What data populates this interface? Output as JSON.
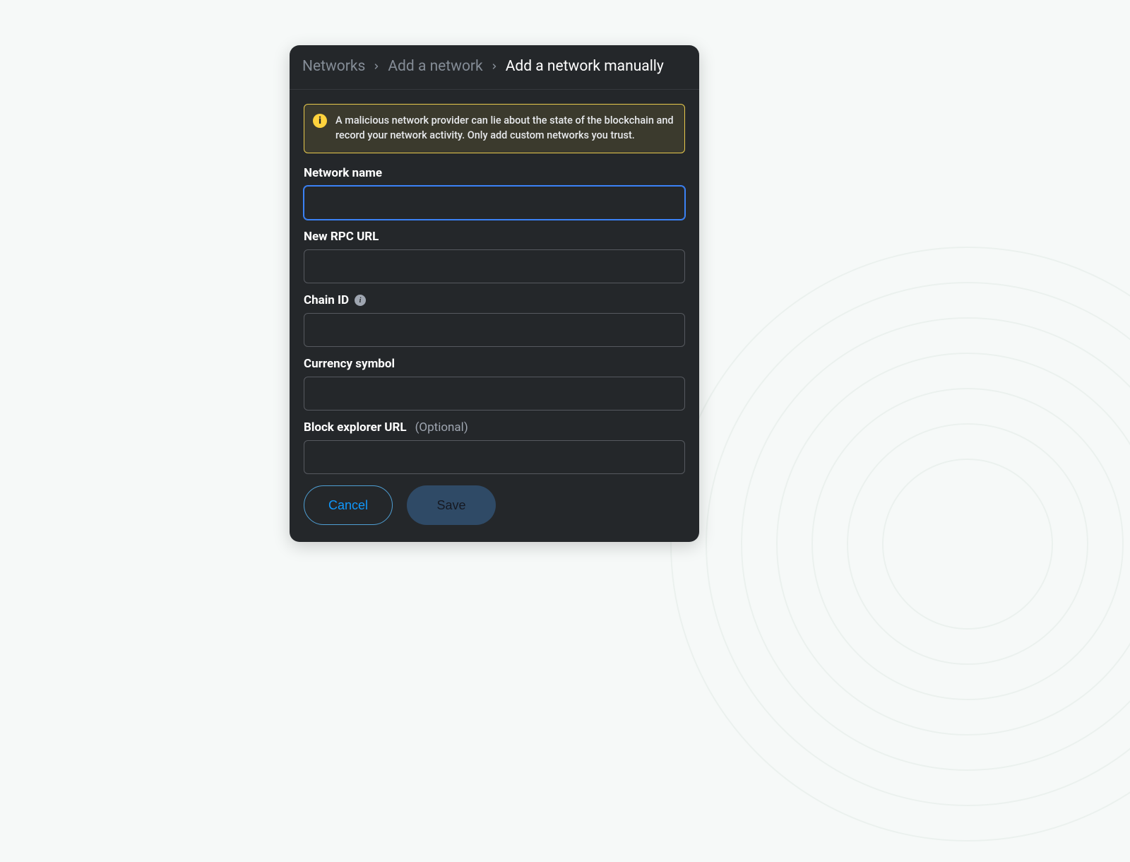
{
  "breadcrumb": {
    "items": [
      {
        "label": "Networks",
        "current": false
      },
      {
        "label": "Add a network",
        "current": false
      },
      {
        "label": "Add a network manually",
        "current": true
      }
    ]
  },
  "warning": {
    "text": "A malicious network provider can lie about the state of the blockchain and record your network activity. Only add custom networks you trust."
  },
  "form": {
    "network_name": {
      "label": "Network name",
      "value": ""
    },
    "rpc_url": {
      "label": "New RPC URL",
      "value": ""
    },
    "chain_id": {
      "label": "Chain ID",
      "value": ""
    },
    "currency": {
      "label": "Currency symbol",
      "value": ""
    },
    "explorer": {
      "label": "Block explorer URL",
      "optional_label": "(Optional)",
      "value": ""
    }
  },
  "actions": {
    "cancel": "Cancel",
    "save": "Save"
  }
}
